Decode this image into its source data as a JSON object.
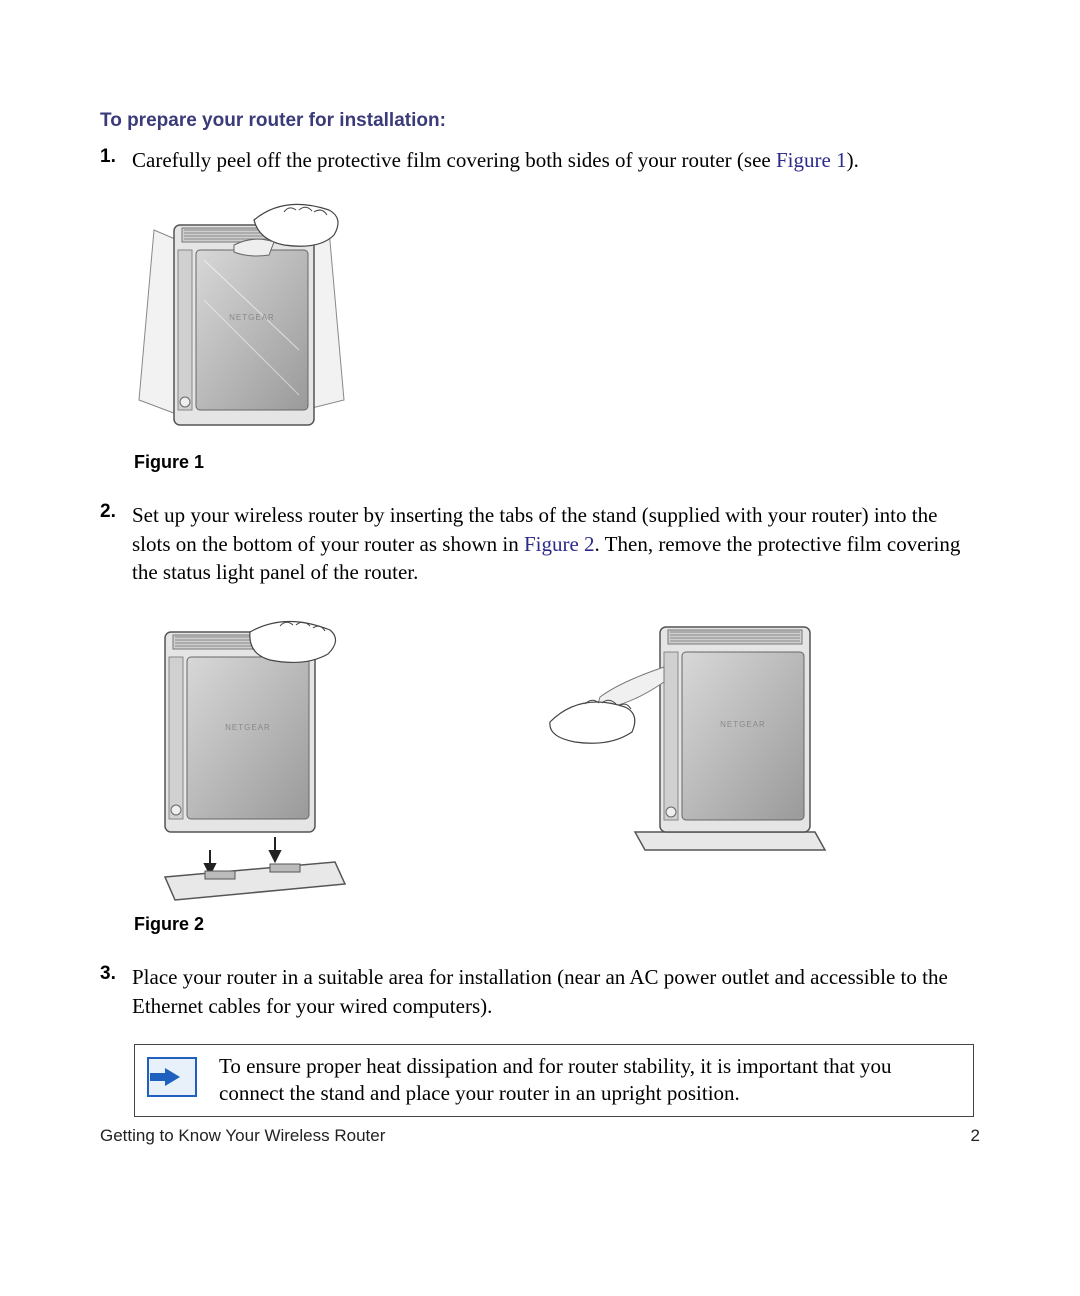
{
  "heading": "To prepare your router for installation:",
  "steps": [
    {
      "num": "1.",
      "text_before_ref": "Carefully peel off the protective film covering both sides of your router (see ",
      "ref": "Figure 1",
      "text_after_ref": ")."
    },
    {
      "num": "2.",
      "text_before_ref": "Set up your wireless router by inserting the tabs of the stand (supplied with your router) into the slots on the bottom of your router as shown in ",
      "ref": "Figure 2",
      "text_after_ref": ". Then, remove the protective film covering the status light panel of the router."
    },
    {
      "num": "3.",
      "text_before_ref": "Place your router in a suitable area for installation (near an AC power outlet and accessible to the Ethernet cables for your wired computers).",
      "ref": "",
      "text_after_ref": ""
    }
  ],
  "figure_captions": {
    "fig1": "Figure 1",
    "fig2": "Figure 2"
  },
  "note": "To ensure proper heat dissipation and for router stability, it is important that you connect the stand and place your router in an upright position.",
  "footer": {
    "left": "Getting to Know Your Wireless Router",
    "right": "2"
  }
}
